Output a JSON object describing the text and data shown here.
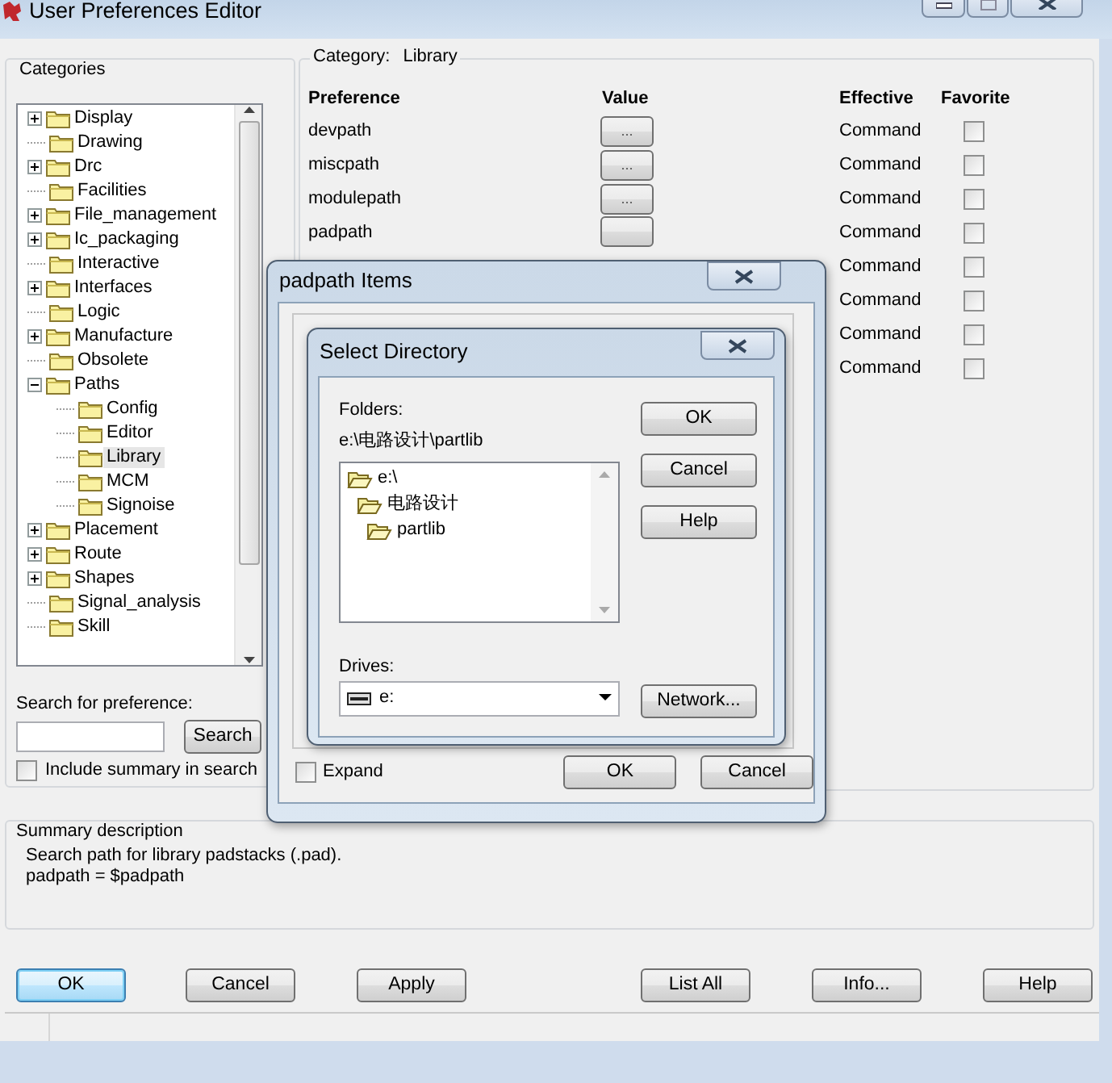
{
  "window": {
    "title": "User Preferences Editor"
  },
  "categories": {
    "title": "Categories",
    "tree": [
      {
        "label": "Display",
        "expanded": false,
        "selected": false
      },
      {
        "label": "Drawing",
        "selected": false
      },
      {
        "label": "Drc",
        "expanded": false,
        "selected": false
      },
      {
        "label": "Facilities",
        "selected": false
      },
      {
        "label": "File_management",
        "expanded": false,
        "selected": false
      },
      {
        "label": "Ic_packaging",
        "expanded": false,
        "selected": false
      },
      {
        "label": "Interactive",
        "selected": false
      },
      {
        "label": "Interfaces",
        "expanded": false,
        "selected": false
      },
      {
        "label": "Logic",
        "selected": false
      },
      {
        "label": "Manufacture",
        "expanded": false,
        "selected": false
      },
      {
        "label": "Obsolete",
        "selected": false
      },
      {
        "label": "Paths",
        "expanded": true,
        "selected": false,
        "children": [
          {
            "label": "Config",
            "selected": false
          },
          {
            "label": "Editor",
            "selected": false
          },
          {
            "label": "Library",
            "selected": true
          },
          {
            "label": "MCM",
            "selected": false
          },
          {
            "label": "Signoise",
            "selected": false
          }
        ]
      },
      {
        "label": "Placement",
        "expanded": false,
        "selected": false
      },
      {
        "label": "Route",
        "expanded": false,
        "selected": false
      },
      {
        "label": "Shapes",
        "expanded": false,
        "selected": false
      },
      {
        "label": "Signal_analysis",
        "selected": false
      },
      {
        "label": "Skill",
        "selected": false
      }
    ]
  },
  "search": {
    "label": "Search for preference:",
    "button": "Search",
    "include_summary": {
      "label": "Include summary in search",
      "checked": false
    }
  },
  "preferences": {
    "category_label": "Category:",
    "category": "Library",
    "columns": [
      "Preference",
      "Value",
      "Effective",
      "Favorite"
    ],
    "rows": [
      {
        "preference": "devpath",
        "value_button": true,
        "value": "...",
        "effective": "Command",
        "favorite": false
      },
      {
        "preference": "miscpath",
        "value_button": true,
        "value": "...",
        "effective": "Command",
        "favorite": false
      },
      {
        "preference": "modulepath",
        "value_button": true,
        "value": "...",
        "effective": "Command",
        "favorite": false
      },
      {
        "preference": "padpath",
        "value_button": true,
        "effective": "Command",
        "favorite": false
      },
      {
        "value_button": false,
        "effective": "Command",
        "favorite": false
      },
      {
        "value_button": false,
        "effective": "Command",
        "favorite": false
      },
      {
        "value_button": false,
        "effective": "Command",
        "favorite": false
      },
      {
        "value_button": false,
        "effective": "Command",
        "favorite": false
      }
    ]
  },
  "summary": {
    "title": "Summary description",
    "lines": [
      "Search path for library padstacks (.pad).",
      "padpath = $padpath"
    ]
  },
  "buttons": [
    {
      "label": "OK",
      "default": true
    },
    {
      "label": "Cancel",
      "default": false
    },
    {
      "label": "Apply",
      "default": false
    },
    {
      "label": "List All",
      "default": false
    },
    {
      "label": "Info...",
      "default": false
    },
    {
      "label": "Help",
      "default": false
    }
  ],
  "items_dialog": {
    "title": "padpath Items",
    "expand": {
      "label": "Expand",
      "checked": false
    },
    "buttons": [
      "OK",
      "Cancel"
    ]
  },
  "select_directory": {
    "title": "Select Directory",
    "folders_label": "Folders:",
    "path": "e:\\电路设计\\partlib",
    "folders": [
      {
        "name": "e:\\",
        "children": [
          {
            "name": "电路设计",
            "children": [
              {
                "name": "partlib"
              }
            ]
          }
        ]
      }
    ],
    "drives_label": "Drives:",
    "drive": "e:",
    "buttons": [
      "OK",
      "Cancel",
      "Help"
    ],
    "network_button": "Network..."
  }
}
